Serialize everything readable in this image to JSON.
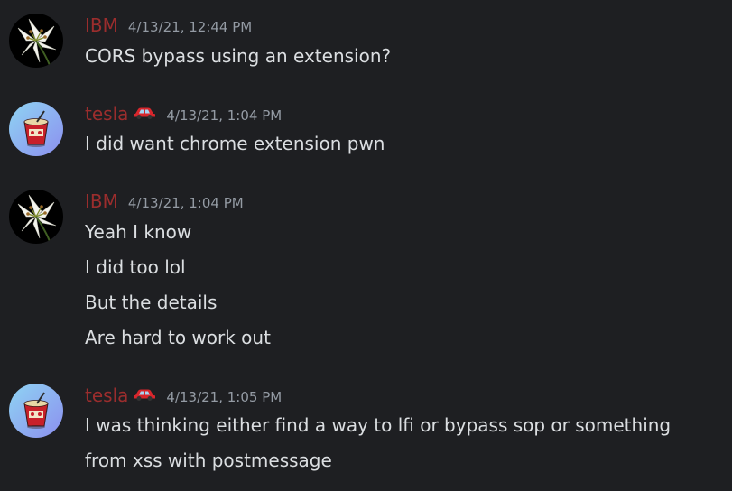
{
  "colors": {
    "background": "#1e1f22",
    "username": "#9b2d2d",
    "timestamp": "#949ba4",
    "message_text": "#dbdee1"
  },
  "messages": [
    {
      "author": "IBM",
      "avatar_icon": "white-lily-flower-avatar",
      "timestamp": "4/13/21, 12:44 PM",
      "lines": [
        "CORS bypass using an extension?"
      ]
    },
    {
      "author": "tesla",
      "author_emoji": "red-car-icon",
      "avatar_icon": "red-popcorn-bucket-avatar",
      "timestamp": "4/13/21, 1:04 PM",
      "lines": [
        "I did want chrome extension pwn"
      ]
    },
    {
      "author": "IBM",
      "avatar_icon": "white-lily-flower-avatar",
      "timestamp": "4/13/21, 1:04 PM",
      "lines": [
        "Yeah I know",
        "I did too lol",
        "But the details",
        "Are hard to work out"
      ]
    },
    {
      "author": "tesla",
      "author_emoji": "red-car-icon",
      "avatar_icon": "red-popcorn-bucket-avatar",
      "timestamp": "4/13/21, 1:05 PM",
      "lines": [
        "I was thinking either find a way to lfi or bypass sop or something",
        "from xss with postmessage"
      ]
    }
  ]
}
